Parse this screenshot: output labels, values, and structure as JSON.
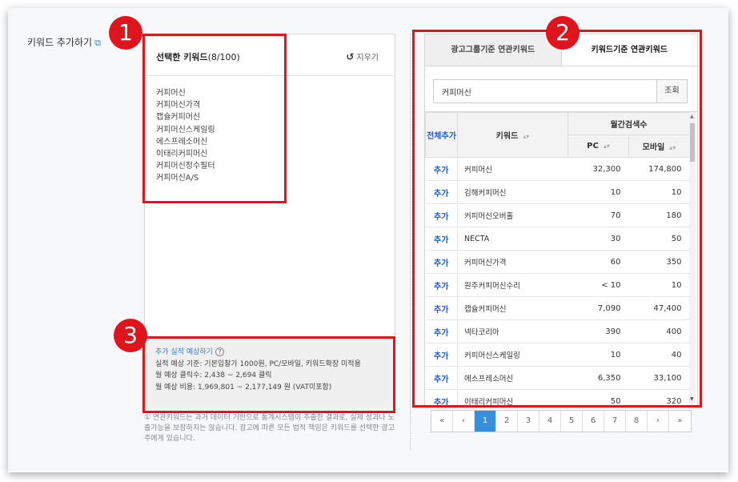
{
  "header": {
    "title": "키워드 추가하기",
    "ext_icon": "external-link-icon"
  },
  "selected": {
    "title": "선택한 키워드",
    "count": "(8/100)",
    "reset_label": "지우기",
    "reset_icon": "refresh-icon",
    "keywords": [
      "커피머신",
      "커피머신가격",
      "캡슐커피머신",
      "커피머신스케일링",
      "에스프레소머신",
      "이태리커피머신",
      "커피머신정수필터",
      "커피머신A/S"
    ]
  },
  "estimate": {
    "link": "추가 실적 예상하기",
    "line1": "실적 예상 기준:  기본입찰가 1000원, PC/모바일, 키워드확장 미적용",
    "line2": "월 예상 클릭수: 2,438 ~ 2,694  클릭",
    "line3": "월 예상 비용: 1,969,801 ~ 2,177,149  원 (VAT미포함)"
  },
  "note": "① 연관키워드는 과거 데이터 기반으로 통계시스템이 추출한 결과로, 실제 성과나 노출가능을 보장하지는 않습니다. 광고에 따른 모든 법적 책임은 키워드를 선택한 광고주에게 있습니다.",
  "tabs": [
    "광고그룹기준 연관키워드",
    "키워드기준 연관키워드"
  ],
  "search": {
    "value": "커피머신",
    "button": "조회"
  },
  "table": {
    "col_add_all": "전체추가",
    "col_keyword": "키워드",
    "col_monthly": "월간검색수",
    "col_pc": "PC",
    "col_mobile": "모바일",
    "add_label": "추가",
    "rows": [
      {
        "kw": "커피머신",
        "pc": "32,300",
        "mobile": "174,800"
      },
      {
        "kw": "김해커피머신",
        "pc": "10",
        "mobile": "10"
      },
      {
        "kw": "커피머신오버홀",
        "pc": "70",
        "mobile": "180"
      },
      {
        "kw": "NECTA",
        "pc": "30",
        "mobile": "50"
      },
      {
        "kw": "커피머신가격",
        "pc": "60",
        "mobile": "350"
      },
      {
        "kw": "원주커피머신수리",
        "pc": "< 10",
        "mobile": "10"
      },
      {
        "kw": "캡슐커피머신",
        "pc": "7,090",
        "mobile": "47,400"
      },
      {
        "kw": "넥타코리아",
        "pc": "390",
        "mobile": "400"
      },
      {
        "kw": "커피머신스케일링",
        "pc": "10",
        "mobile": "40"
      },
      {
        "kw": "에스프레소머신",
        "pc": "6,350",
        "mobile": "33,100"
      },
      {
        "kw": "이태리커피머신",
        "pc": "50",
        "mobile": "320"
      }
    ]
  },
  "pager": [
    "«",
    "‹",
    "1",
    "2",
    "3",
    "4",
    "5",
    "6",
    "7",
    "8",
    "›",
    "»"
  ],
  "badges": [
    "1",
    "2",
    "3"
  ],
  "colors": {
    "highlight": "#e0141c",
    "link": "#3a7bd5",
    "active_page": "#3a8ed8"
  }
}
